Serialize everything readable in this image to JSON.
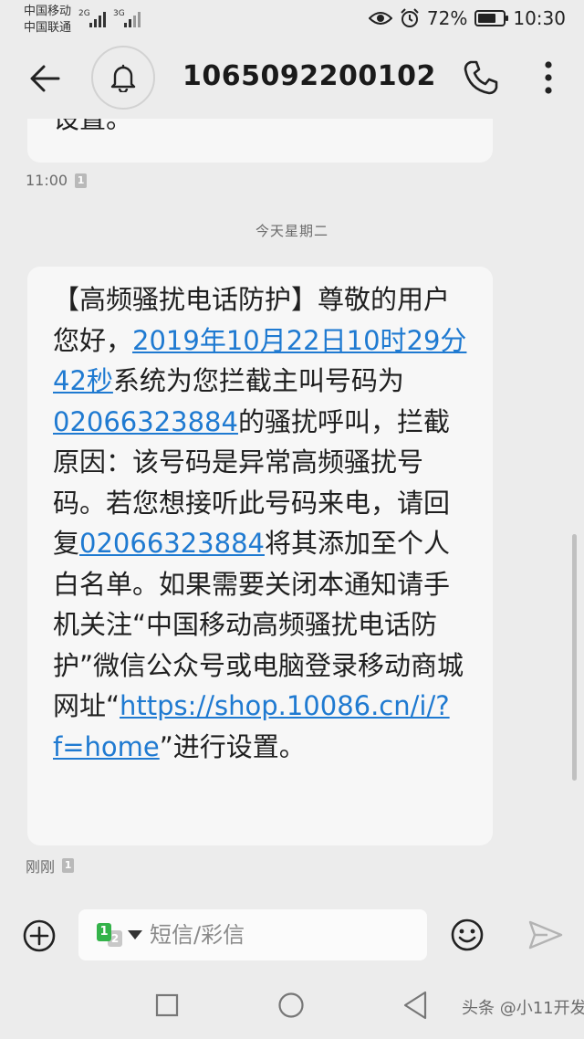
{
  "status_bar": {
    "carrier1": "中国移动",
    "carrier2": "中国联通",
    "sig1_label": "2G",
    "sig2_label": "3G",
    "battery": "72%",
    "time": "10:30"
  },
  "header": {
    "back_icon": "arrow-left-icon",
    "notification_icon": "bell-icon",
    "contact": "1065092200102",
    "call_icon": "phone-icon",
    "more_icon": "more-vertical-icon"
  },
  "messages": {
    "previous": {
      "tail_text": "设置。",
      "time": "11:00",
      "sim": "1"
    },
    "date_divider": "今天星期二",
    "latest": {
      "p1": "【高频骚扰电话防护】尊敬的用户您好，",
      "link_datetime": "2019年10月22日10时29分42秒",
      "p2": "系统为您拦截主叫号码为",
      "link_number1": "02066323884",
      "p3": "的骚扰呼叫，拦截原因：该号码是异常高频骚扰号码。若您想接听此号码来电，请回复",
      "link_number2": "02066323884",
      "p4": "将其添加至个人白名单。如果需要关闭本通知请手机关注“中国移动高频骚扰电话防护”微信公众号或电脑登录移动商城网址“",
      "link_url": "https://shop.10086.cn/i/?f=home",
      "p5": "”进行设置。",
      "time": "刚刚",
      "sim": "1"
    }
  },
  "composer": {
    "add_icon": "plus-circle-icon",
    "sim_primary": "1",
    "sim_secondary": "2",
    "placeholder": "短信/彩信",
    "emoji_icon": "smiley-icon",
    "send_icon": "send-icon"
  },
  "nav_bar": {
    "watermark": "头条 @小11开发"
  }
}
